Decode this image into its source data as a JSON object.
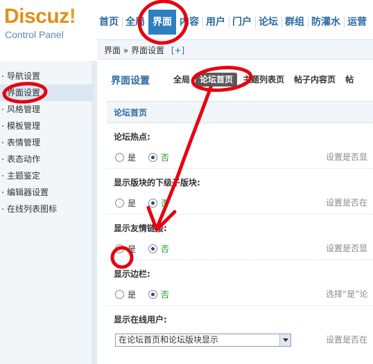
{
  "logo": {
    "brand": "Discuz",
    "bang": "!",
    "subtitle": "Control Panel"
  },
  "topnav": [
    "首页",
    "全局",
    "界面",
    "内容",
    "用户",
    "门户",
    "论坛",
    "群组",
    "防灌水",
    "运营"
  ],
  "breadcrumb": {
    "text": "界面 » 界面设置",
    "add": "[+]"
  },
  "sidebar": {
    "items": [
      "导航设置",
      "界面设置",
      "风格管理",
      "模板管理",
      "表情管理",
      "表态动作",
      "主题鉴定",
      "编辑器设置",
      "在线列表图标"
    ]
  },
  "main": {
    "title": "界面设置",
    "subtabs": [
      "全局",
      "论坛首页",
      "主题列表页",
      "帖子内容页",
      "帖"
    ],
    "section": "论坛首页",
    "rows": [
      {
        "label": "论坛热点:",
        "yes": "是",
        "no": "否",
        "selected": "no",
        "hint": "设置是否显"
      },
      {
        "label": "显示版块的下级子版块:",
        "yes": "是",
        "no": "否",
        "selected": "no",
        "hint": "设置是否在"
      },
      {
        "label": "显示友情链接:",
        "yes": "是",
        "no": "否",
        "selected": "no",
        "hint": "设置是否显"
      },
      {
        "label": "显示边栏:",
        "yes": "是",
        "no": "否",
        "selected": "no",
        "hint": "选择“是”论"
      }
    ],
    "online": {
      "label": "显示在线用户:",
      "value": "在论坛首页和论坛版块显示",
      "hint": "设置是否在"
    }
  },
  "colors": {
    "accent": "#2c7fc0",
    "annotation": "#e8000f",
    "selected_green": "#1a9a1a"
  }
}
